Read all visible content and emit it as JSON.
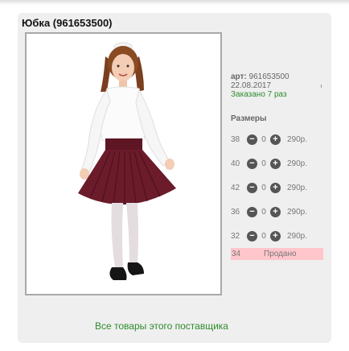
{
  "product": {
    "title": "Юбка (961653500)",
    "article_label": "арт:",
    "article": "961653500",
    "date": "22.08.2017",
    "ordered": "Заказано 7 раз",
    "sizes_label": "Размеры"
  },
  "sizes": [
    {
      "size": "38",
      "qty": "0",
      "price": "290р."
    },
    {
      "size": "40",
      "qty": "0",
      "price": "290р."
    },
    {
      "size": "42",
      "qty": "0",
      "price": "290р."
    },
    {
      "size": "36",
      "qty": "0",
      "price": "290р."
    },
    {
      "size": "32",
      "qty": "0",
      "price": "290р."
    }
  ],
  "sold": {
    "size": "34",
    "label": "Продано"
  },
  "supplier_link": "Все товары этого поставщика",
  "icons": {
    "minus": "minus-icon",
    "plus": "plus-icon"
  },
  "colors": {
    "accent_green": "#2e8b2e",
    "sold_bg": "#ffc6cc",
    "card_bg": "#efefef",
    "skirt": "#6b1b2a"
  }
}
